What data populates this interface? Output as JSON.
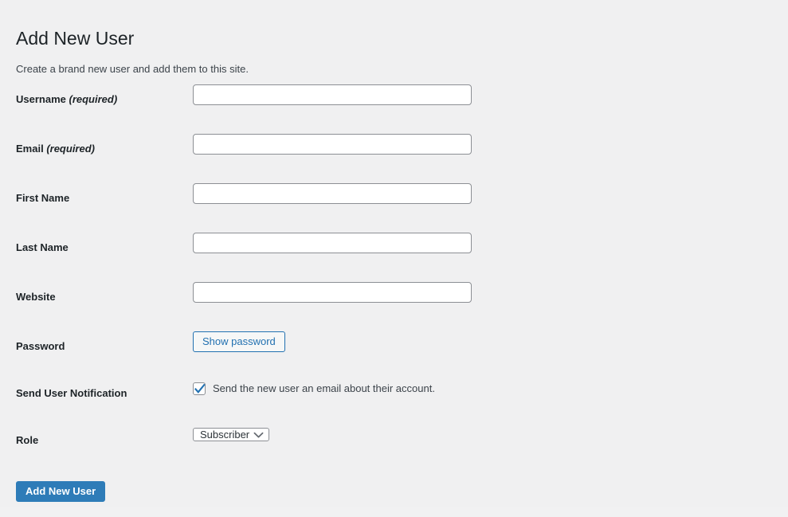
{
  "page": {
    "title": "Add New User",
    "subtitle": "Create a brand new user and add them to this site.",
    "background_color": "#f0f0f1"
  },
  "theme": {
    "accent_blue": "#2271b1",
    "primary_button_bg": "#2e7cb8",
    "input_border": "#8c8f94",
    "label_color": "#1d2327",
    "text_color": "#3c434a"
  },
  "form": {
    "rows": [
      {
        "label": "Username",
        "required_note": "(required)",
        "type": "text",
        "value": "",
        "placeholder": ""
      },
      {
        "label": "Email",
        "required_note": "(required)",
        "type": "text",
        "value": "",
        "placeholder": ""
      },
      {
        "label": "First Name",
        "required_note": "",
        "type": "text",
        "value": "",
        "placeholder": ""
      },
      {
        "label": "Last Name",
        "required_note": "",
        "type": "text",
        "value": "",
        "placeholder": ""
      },
      {
        "label": "Website",
        "required_note": "",
        "type": "text",
        "value": "",
        "placeholder": ""
      }
    ],
    "password": {
      "label": "Password",
      "show_password_button": "Show password"
    },
    "notification": {
      "label": "Send User Notification",
      "checkbox_label": "Send the new user an email about their account.",
      "checked": true,
      "check_icon": "checkmark-icon"
    },
    "role": {
      "label": "Role",
      "selected": "Subscriber",
      "chevron_icon": "chevron-down-icon"
    },
    "submit": {
      "label": "Add New User"
    }
  }
}
